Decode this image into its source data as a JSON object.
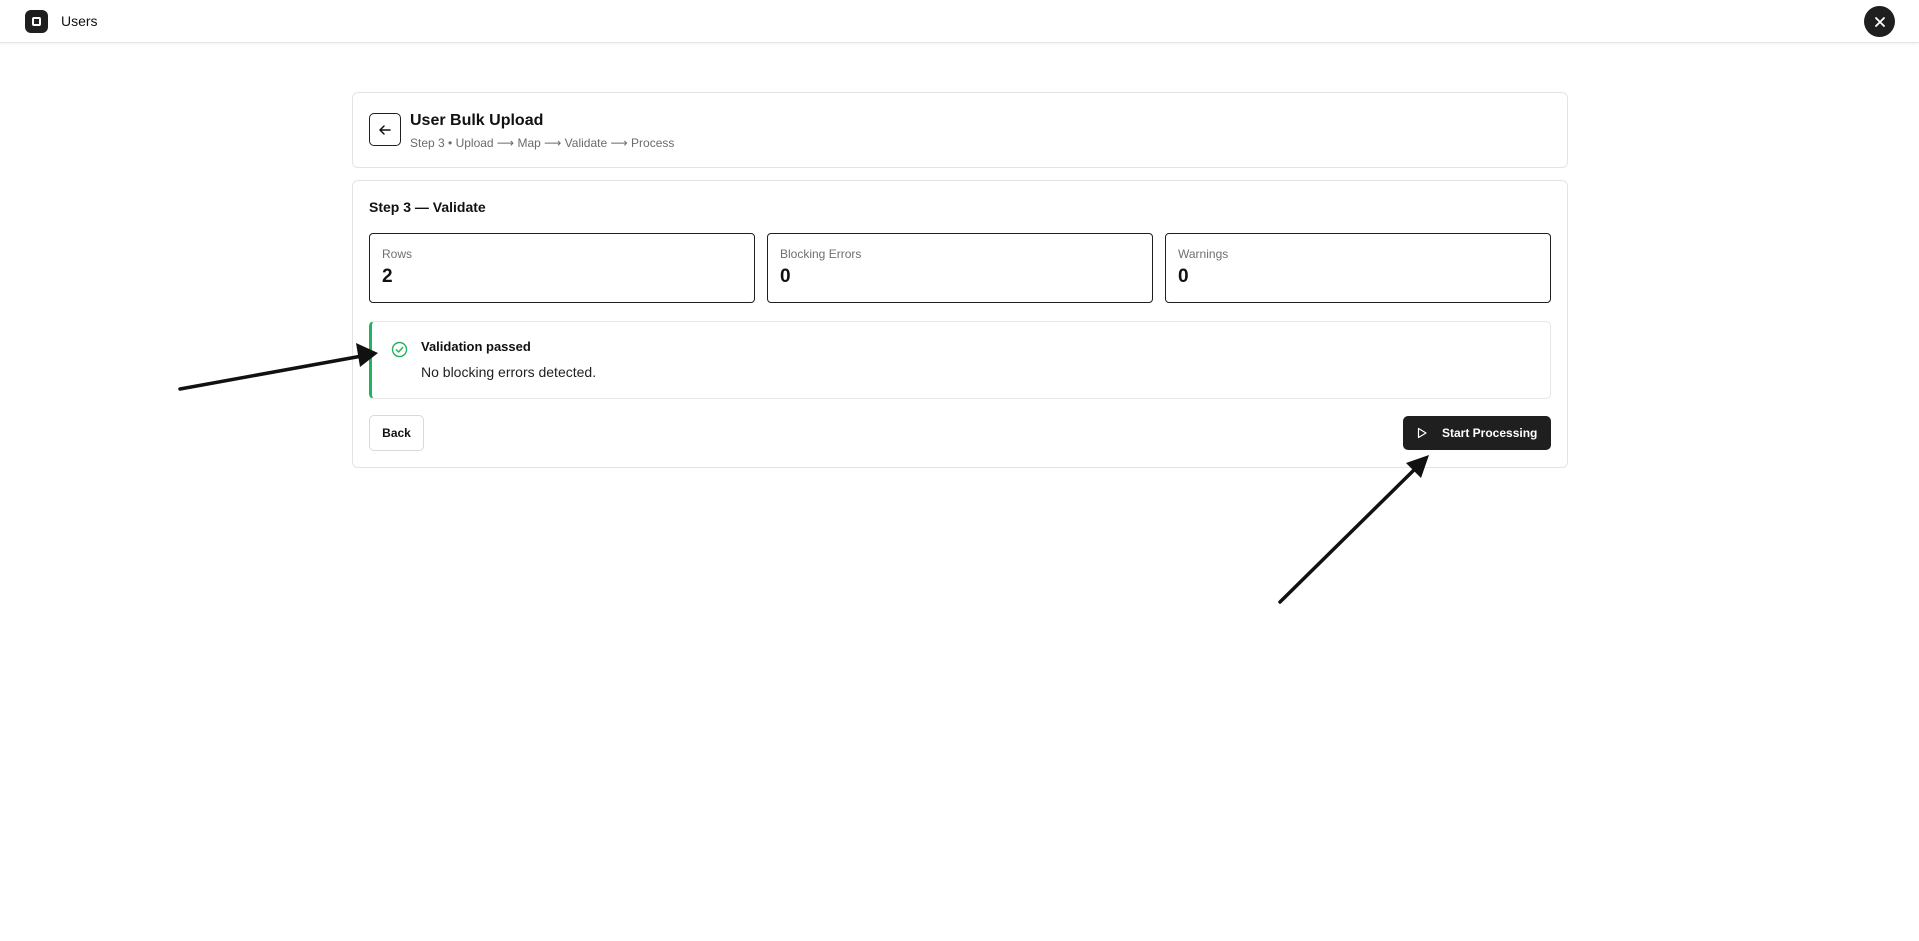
{
  "topbar": {
    "title": "Users",
    "logo_icon": "app-logo-icon",
    "close_icon": "close-icon"
  },
  "header": {
    "title": "User Bulk Upload",
    "breadcrumb": "Step 3 • Upload ⟶ Map ⟶ Validate ⟶ Process",
    "back_icon": "arrow-left-icon"
  },
  "step": {
    "title": "Step 3 — Validate",
    "stats": [
      {
        "label": "Rows",
        "value": "2"
      },
      {
        "label": "Blocking Errors",
        "value": "0"
      },
      {
        "label": "Warnings",
        "value": "0"
      }
    ]
  },
  "alert": {
    "title": "Validation passed",
    "message": "No blocking errors detected.",
    "icon": "check-circle-icon",
    "accent_color": "#22b35e"
  },
  "actions": {
    "back_label": "Back",
    "start_label": "Start Processing",
    "start_icon": "play-icon"
  },
  "colors": {
    "primary": "#1f1f1f",
    "success": "#22b35e"
  }
}
